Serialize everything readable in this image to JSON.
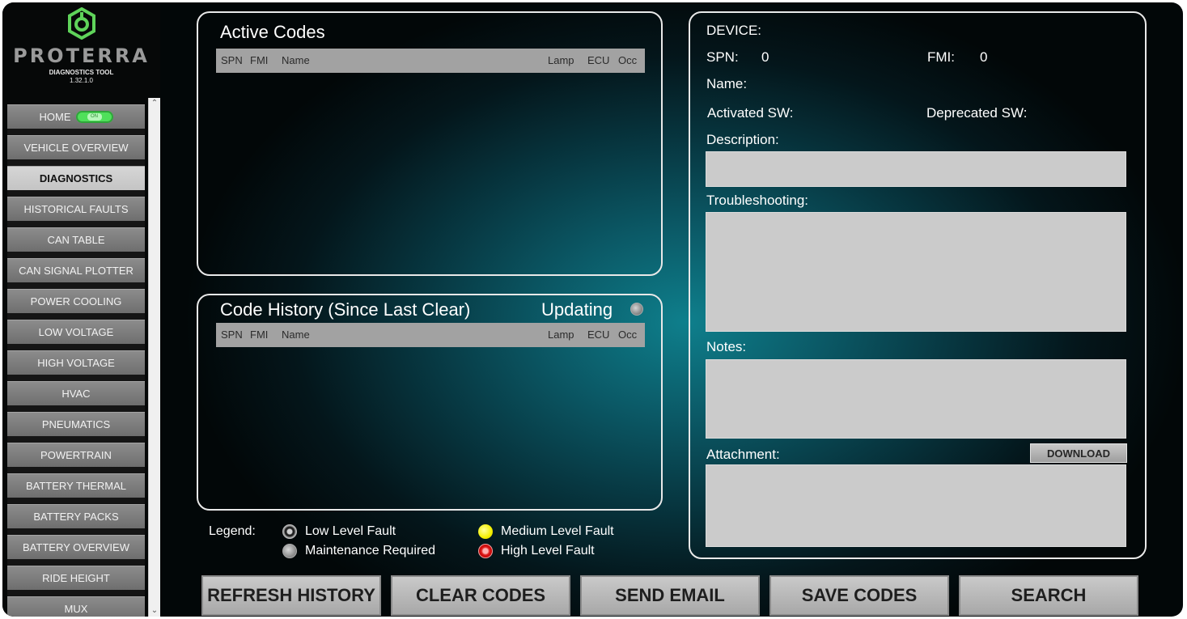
{
  "brand": {
    "name": "PROTERRA",
    "tool_name": "DIAGNOSTICS TOOL",
    "version": "1.32.1.0",
    "logo_color": "#5fd35a"
  },
  "nav": {
    "home_label": "HOME",
    "home_toggle_text": "ON",
    "items": [
      "VEHICLE OVERVIEW",
      "DIAGNOSTICS",
      "HISTORICAL FAULTS",
      "CAN TABLE",
      "CAN SIGNAL PLOTTER",
      "POWER COOLING",
      "LOW VOLTAGE",
      "HIGH VOLTAGE",
      "HVAC",
      "PNEUMATICS",
      "POWERTRAIN",
      "BATTERY THERMAL",
      "BATTERY PACKS",
      "BATTERY OVERVIEW",
      "RIDE HEIGHT",
      "MUX"
    ],
    "active": "DIAGNOSTICS",
    "scroll_up_icon": "chevron-up-icon",
    "scroll_down_icon": "chevron-down-icon"
  },
  "active_codes": {
    "title": "Active Codes",
    "columns": {
      "spn": "SPN",
      "fmi": "FMI",
      "name": "Name",
      "lamp": "Lamp",
      "ecu": "ECU",
      "occ": "Occ"
    },
    "rows": []
  },
  "code_history": {
    "title": "Code History (Since Last Clear)",
    "updating_label": "Updating",
    "columns": {
      "spn": "SPN",
      "fmi": "FMI",
      "name": "Name",
      "lamp": "Lamp",
      "ecu": "ECU",
      "occ": "Occ"
    },
    "rows": []
  },
  "legend": {
    "label": "Legend:",
    "low": "Low Level Fault",
    "maintenance": "Maintenance Required",
    "medium": "Medium Level Fault",
    "high": "High Level Fault",
    "colors": {
      "low": "#9d9d9d",
      "maintenance": "#8b8b8b",
      "medium": "#f4f000",
      "high": "#e01818"
    }
  },
  "details": {
    "device_label": "DEVICE:",
    "spn_label": "SPN:",
    "spn_value": "0",
    "fmi_label": "FMI:",
    "fmi_value": "0",
    "name_label": "Name:",
    "activated_sw_label": "Activated SW:",
    "deprecated_sw_label": "Deprecated SW:",
    "description_label": "Description:",
    "troubleshooting_label": "Troubleshooting:",
    "notes_label": "Notes:",
    "attachment_label": "Attachment:",
    "download_label": "DOWNLOAD"
  },
  "actions": {
    "refresh_history": "REFRESH HISTORY",
    "clear_codes": "CLEAR CODES",
    "send_email": "SEND EMAIL",
    "save_codes": "SAVE CODES",
    "search": "SEARCH"
  }
}
